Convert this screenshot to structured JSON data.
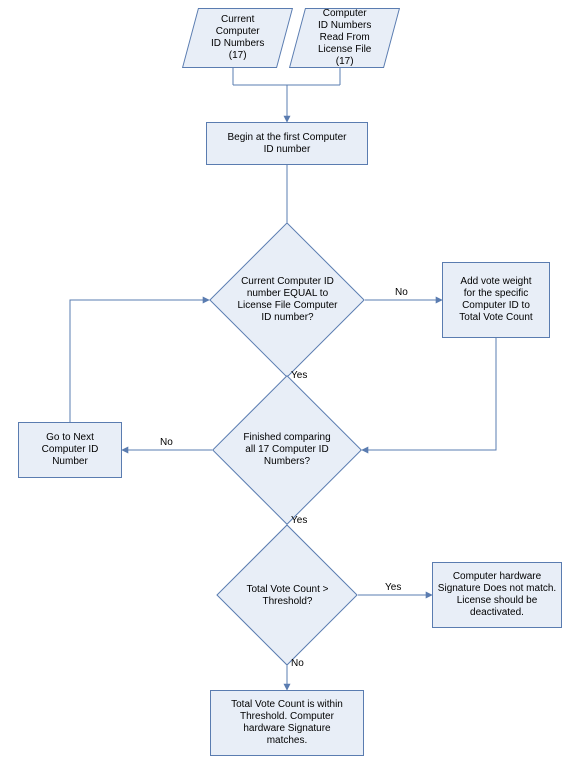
{
  "nodes": {
    "input_current": "Current\nComputer\nID Numbers\n(17)",
    "input_license": "Computer\nID Numbers\nRead From\nLicense File\n(17)",
    "begin": "Begin at the first Computer\nID number",
    "decision_equal": "Current Computer ID\nnumber EQUAL to\nLicense File Computer\nID number?",
    "add_vote": "Add vote weight\nfor the specific\nComputer ID to\nTotal Vote Count",
    "decision_finished": "Finished comparing\nall 17 Computer ID\nNumbers?",
    "go_next": "Go to Next\nComputer ID\nNumber",
    "decision_threshold": "Total Vote Count >\nThreshold?",
    "no_match": "Computer hardware\nSignature Does not match.\nLicense should be\ndeactivated.",
    "within": "Total Vote Count is within\nThreshold.  Computer\nhardware Signature\nmatches."
  },
  "labels": {
    "yes": "Yes",
    "no": "No"
  }
}
